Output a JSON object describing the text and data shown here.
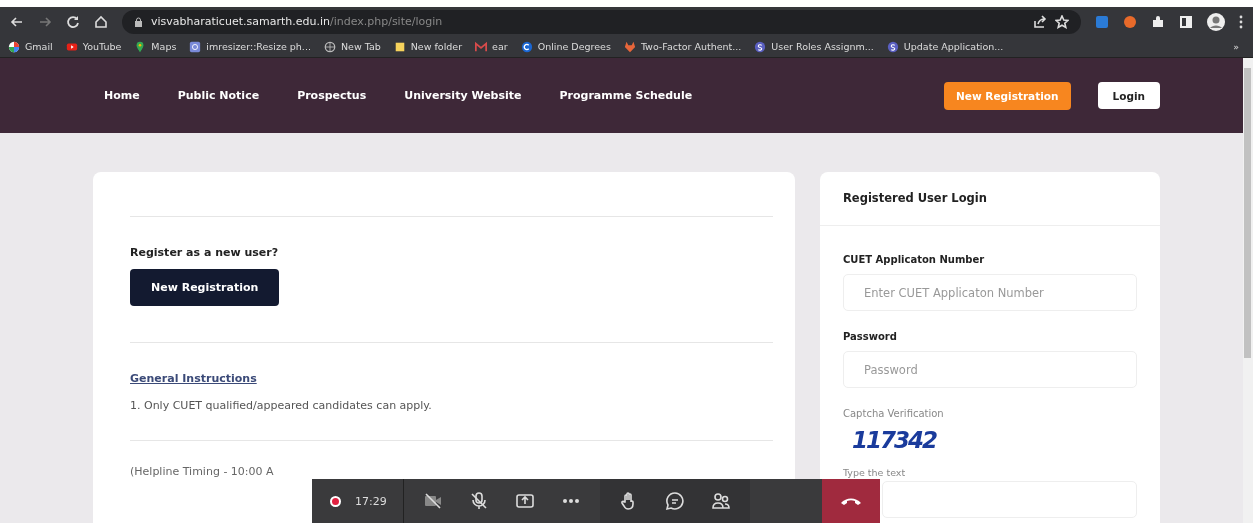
{
  "browser": {
    "url_host": "visvabharaticuet.samarth.edu.in",
    "url_path": "/index.php/site/login",
    "bookmarks": [
      "Gmail",
      "YouTube",
      "Maps",
      "imresizer::Resize ph...",
      "New Tab",
      "New folder",
      "ear",
      "Online Degrees",
      "Two-Factor Authent...",
      "User Roles Assignm...",
      "Update Application..."
    ],
    "more": "»"
  },
  "nav": {
    "links": [
      "Home",
      "Public Notice",
      "Prospectus",
      "University Website",
      "Programme Schedule"
    ],
    "register_button": "New Registration",
    "login_button": "Login"
  },
  "register_card": {
    "question": "Register as a new user?",
    "button": "New Registration",
    "instructions_title": "General Instructions",
    "instructions": [
      "1. Only CUET qualified/appeared candidates can apply."
    ],
    "helpline": "(Helpline Timing - 10:00 A"
  },
  "login_card": {
    "title": "Registered User Login",
    "fields": [
      {
        "label": "CUET Applicaton Number",
        "placeholder": "Enter CUET Applicaton Number"
      },
      {
        "label": "Password",
        "placeholder": "Password"
      }
    ],
    "captcha_label": "Captcha Verification",
    "captcha": "117342",
    "type_label": "Type the text"
  },
  "meeting_bar": {
    "time": "17:29",
    "recording": true
  }
}
